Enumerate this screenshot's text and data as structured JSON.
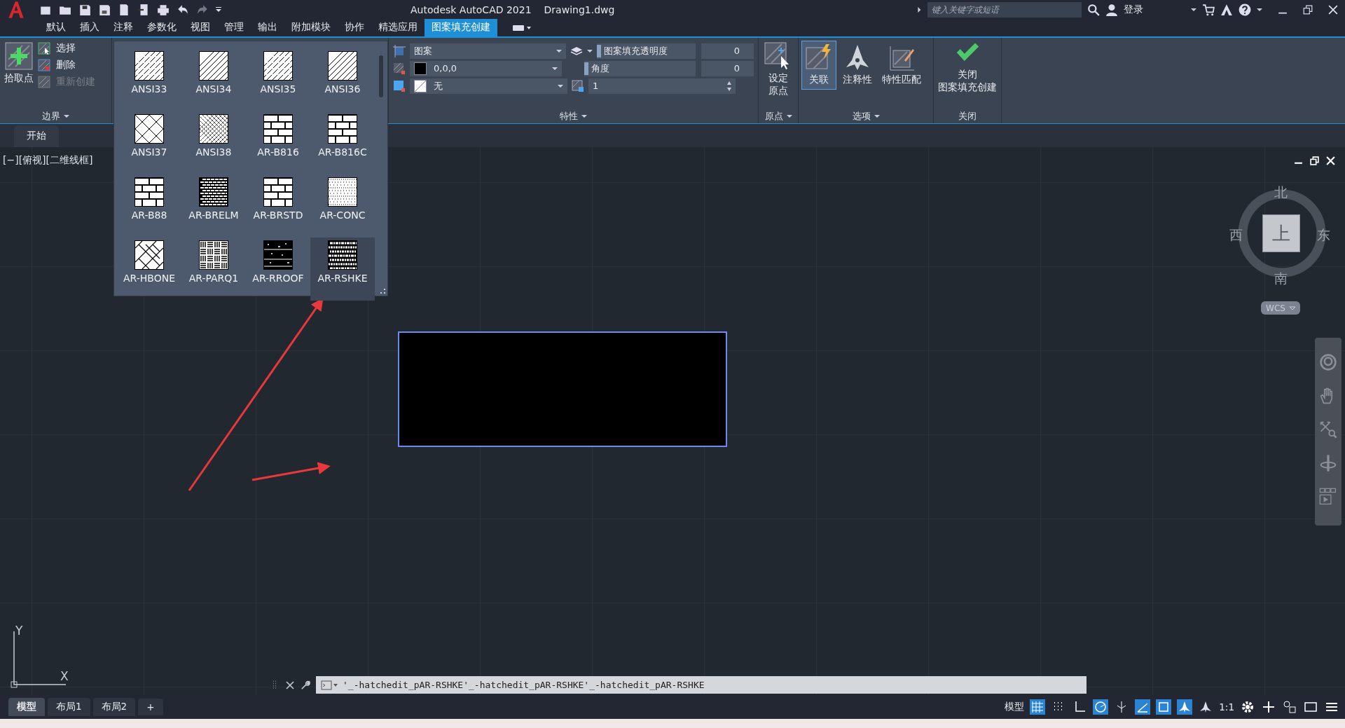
{
  "window": {
    "title": "Autodesk AutoCAD 2021",
    "document": "Drawing1.dwg",
    "search_placeholder": "键入关键字或短语",
    "user": "登录"
  },
  "ribbon_tabs": [
    {
      "label": "默认",
      "selected": false
    },
    {
      "label": "插入",
      "selected": false
    },
    {
      "label": "注释",
      "selected": false
    },
    {
      "label": "参数化",
      "selected": false
    },
    {
      "label": "视图",
      "selected": false
    },
    {
      "label": "管理",
      "selected": false
    },
    {
      "label": "输出",
      "selected": false
    },
    {
      "label": "附加模块",
      "selected": false
    },
    {
      "label": "协作",
      "selected": false
    },
    {
      "label": "精选应用",
      "selected": false
    },
    {
      "label": "图案填充创建",
      "selected": true
    }
  ],
  "boundary_panel": {
    "title": "边界",
    "pick_points": "拾取点",
    "buttons": [
      {
        "label": "选择",
        "disabled": false
      },
      {
        "label": "删除",
        "disabled": false
      },
      {
        "label": "重新创建",
        "disabled": true
      }
    ]
  },
  "pattern_gallery": [
    {
      "label": "ANSI33",
      "kind": "diagonal",
      "selected": false
    },
    {
      "label": "ANSI34",
      "kind": "diagonal",
      "selected": false
    },
    {
      "label": "ANSI35",
      "kind": "diagonal",
      "selected": false
    },
    {
      "label": "ANSI36",
      "kind": "diagonal",
      "selected": false
    },
    {
      "label": "ANSI37",
      "kind": "cross",
      "selected": false
    },
    {
      "label": "ANSI38",
      "kind": "cross-fine",
      "selected": false
    },
    {
      "label": "AR-B816",
      "kind": "brick",
      "selected": false
    },
    {
      "label": "AR-B816C",
      "kind": "brick",
      "selected": false
    },
    {
      "label": "AR-B88",
      "kind": "brick",
      "selected": false
    },
    {
      "label": "AR-BRELM",
      "kind": "brick-fine",
      "selected": false
    },
    {
      "label": "AR-BRSTD",
      "kind": "brick",
      "selected": false
    },
    {
      "label": "AR-CONC",
      "kind": "dots",
      "selected": false
    },
    {
      "label": "AR-HBONE",
      "kind": "herringbone",
      "selected": false
    },
    {
      "label": "AR-PARQ1",
      "kind": "parquet",
      "selected": false
    },
    {
      "label": "AR-RROOF",
      "kind": "roof",
      "selected": false
    },
    {
      "label": "AR-RSHKE",
      "kind": "shake",
      "selected": true
    }
  ],
  "properties_panel": {
    "title": "特性",
    "pattern_type": "图案",
    "hatch_color": "0,0,0",
    "background": "无",
    "transparency": {
      "label": "图案填充透明度",
      "value": "0",
      "level": 0
    },
    "angle": {
      "label": "角度",
      "value": "0",
      "level": 0
    },
    "scale": "1"
  },
  "origin_panel": {
    "title": "原点",
    "button": "设定原点"
  },
  "options_panel": {
    "title": "选项",
    "buttons": [
      {
        "label": "关联",
        "selected": true
      },
      {
        "label": "注释性",
        "selected": false
      },
      {
        "label": "特性匹配",
        "selected": false
      }
    ]
  },
  "close_panel": {
    "title": "关闭",
    "button_lines": [
      "关闭",
      "图案填充创建"
    ]
  },
  "file_tabs": [
    {
      "label": "开始"
    }
  ],
  "viewport": {
    "label": "[−][俯视][二维线框]",
    "viewcube": {
      "north": "北",
      "south": "南",
      "west": "西",
      "east": "东",
      "face": "上",
      "ucs": "WCS"
    },
    "ucs_icon": {
      "y": "Y",
      "x": "X"
    }
  },
  "command_line": "'_-hatchedit_pAR-RSHKE'_-hatchedit_pAR-RSHKE'_-hatchedit_pAR-RSHKE",
  "layout_tabs": [
    {
      "label": "模型",
      "selected": true
    },
    {
      "label": "布局1",
      "selected": false
    },
    {
      "label": "布局2",
      "selected": false
    },
    {
      "label": "+",
      "selected": false
    }
  ],
  "status_bar": {
    "space": "模型",
    "scale": "1:1",
    "toggles": [
      {
        "kind": "grid",
        "on": true
      },
      {
        "kind": "snap",
        "on": false
      },
      {
        "kind": "ortho",
        "on": false
      },
      {
        "kind": "polar",
        "on": true
      },
      {
        "kind": "isometric",
        "on": false
      },
      {
        "kind": "osnap-track",
        "on": true
      },
      {
        "kind": "osnap",
        "on": true
      },
      {
        "kind": "annotation",
        "on": true
      }
    ]
  }
}
